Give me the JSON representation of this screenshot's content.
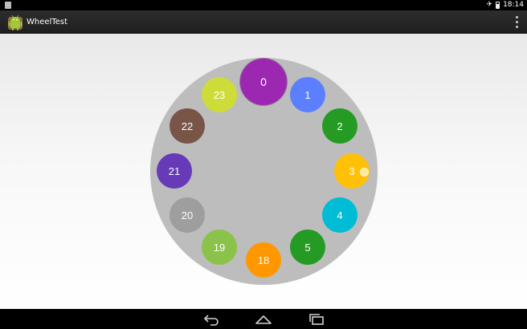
{
  "status_bar": {
    "time": "18:14",
    "icons": [
      "notification-icon",
      "airplane-icon",
      "battery-icon"
    ]
  },
  "action_bar": {
    "title": "WheelTest",
    "app_icon": "android-robot-icon",
    "overflow_icon": "overflow-menu-icon"
  },
  "wheel": {
    "background_color": "#bdbdbd",
    "selected_item": "0",
    "items": [
      {
        "label": "0",
        "color": "#9c27b0"
      },
      {
        "label": "1",
        "color": "#5b7fff"
      },
      {
        "label": "2",
        "color": "#259b24"
      },
      {
        "label": "3",
        "color": "#ffc107"
      },
      {
        "label": "4",
        "color": "#00bcd4"
      },
      {
        "label": "5",
        "color": "#259b24"
      },
      {
        "label": "18",
        "color": "#ff9800"
      },
      {
        "label": "19",
        "color": "#8bc34a"
      },
      {
        "label": "20",
        "color": "#9e9e9e"
      },
      {
        "label": "21",
        "color": "#673ab7"
      },
      {
        "label": "22",
        "color": "#795548"
      },
      {
        "label": "23",
        "color": "#cddc39"
      }
    ]
  },
  "nav_bar": {
    "buttons": [
      "back-icon",
      "home-icon",
      "recents-icon"
    ]
  }
}
